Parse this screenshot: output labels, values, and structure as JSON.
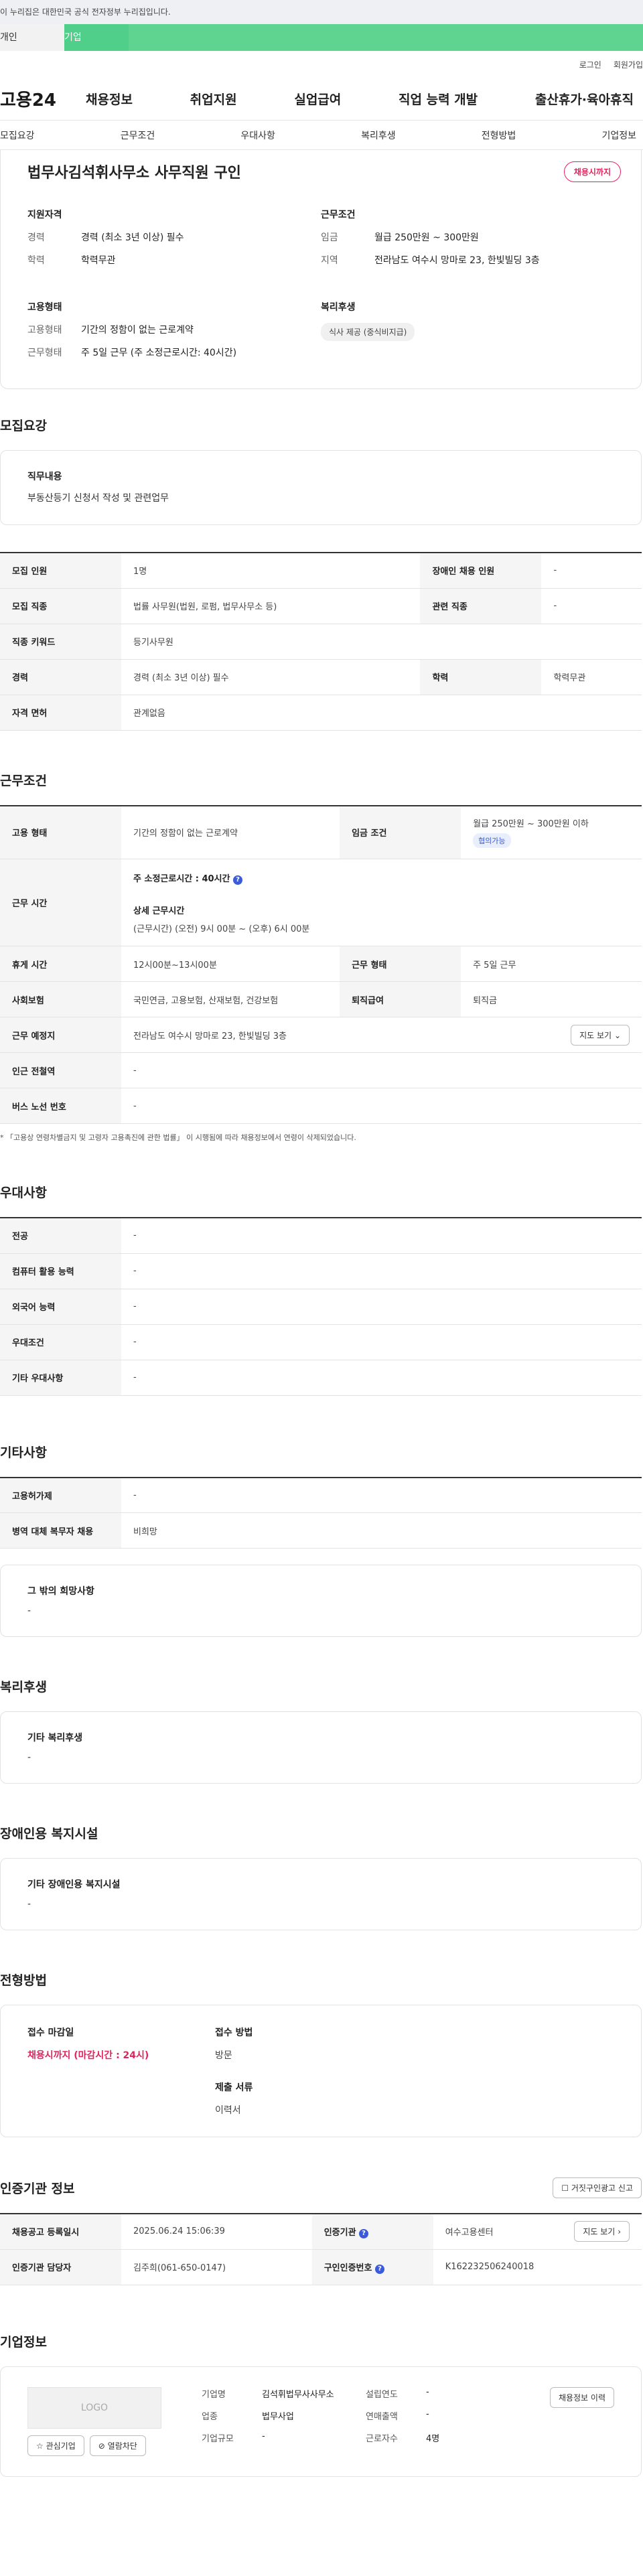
{
  "gov_banner": "이 누리집은 대한민국 공식 전자정부 누리집입니다.",
  "user_tabs": [
    "개인",
    "기업"
  ],
  "util": [
    "로그인",
    "회원가입"
  ],
  "logo": "고용24",
  "gnb": [
    "채용정보",
    "취업지원",
    "실업급여",
    "직업 능력 개발",
    "출산휴가·육아휴직"
  ],
  "subnav": [
    "모집요강",
    "근무조건",
    "우대사항",
    "복리후생",
    "전형방법",
    "기업정보"
  ],
  "summary": {
    "title": "법무사김석휘사무소 사무직원 구인",
    "badge": "채용시까지",
    "qual_label": "지원자격",
    "qual": [
      {
        "k": "경력",
        "v": "경력 (최소 3년 이상) 필수"
      },
      {
        "k": "학력",
        "v": "학력무관"
      }
    ],
    "work_label": "근무조건",
    "work": [
      {
        "k": "임금",
        "v": "월급 250만원 ~ 300만원"
      },
      {
        "k": "지역",
        "v": "전라남도 여수시 망마로 23, 한빛빌딩 3층"
      }
    ],
    "type_label": "고용형태",
    "type": [
      {
        "k": "고용형태",
        "v": "기간의 정함이 없는 근로계약"
      },
      {
        "k": "근무형태",
        "v": "주 5일 근무 (주 소정근로시간: 40시간)"
      }
    ],
    "welfare_label": "복리후생",
    "welfare_chip": "식사 제공 (중식비지급)"
  },
  "recruit": {
    "heading": "모집요강",
    "duty_label": "직무내용",
    "duty": "부동산등기 신청서 작성 및 관련업무",
    "rows": [
      {
        "k1": "모집 인원",
        "v1": "1명",
        "k2": "장애인 채용 인원",
        "v2": "-"
      },
      {
        "k1": "모집 직종",
        "v1": "법률 사무원(법원, 로펌, 법무사무소 등)",
        "k2": "관련 직종",
        "v2": "-"
      },
      {
        "k1": "직종 키워드",
        "v1": "등기사무원"
      },
      {
        "k1": "경력",
        "v1": "경력 (최소 3년 이상) 필수",
        "k2": "학력",
        "v2": "학력무관"
      },
      {
        "k1": "자격 면허",
        "v1": "관계없음"
      }
    ]
  },
  "work": {
    "heading": "근무조건",
    "type_k": "고용 형태",
    "type_v": "기간의 정함이 없는 근로계약",
    "wage_k": "임금 조건",
    "wage_v": "월급 250만원 ~ 300만원 이하",
    "wage_pill": "협의가능",
    "hours_k": "근무 시간",
    "hours_main": "주 소정근로시간 : 40시간",
    "hours_detail_label": "상세 근무시간",
    "hours_detail": "(근무시간) (오전) 9시 00분 ~ (오후) 6시 00분",
    "rest_k": "휴게 시간",
    "rest_v": "12시00분~13시00분",
    "form_k": "근무 형태",
    "form_v": "주 5일 근무",
    "ins_k": "사회보험",
    "ins_v": "국민연금, 고용보험, 산재보험, 건강보험",
    "ret_k": "퇴직급여",
    "ret_v": "퇴직금",
    "place_k": "근무 예정지",
    "place_v": "전라남도 여수시 망마로 23, 한빛빌딩 3층",
    "map_btn": "지도 보기",
    "subway_k": "인근 전철역",
    "subway_v": "-",
    "bus_k": "버스 노선 번호",
    "bus_v": "-",
    "note": "* 「고용상 연령차별금지 및 고령자 고용촉진에 관한 법률」 이 시행됨에 따라 채용정보에서 연령이 삭제되었습니다."
  },
  "pref": {
    "heading": "우대사항",
    "rows": [
      {
        "k": "전공",
        "v": "-"
      },
      {
        "k": "컴퓨터 활용 능력",
        "v": "-"
      },
      {
        "k": "외국어 능력",
        "v": "-"
      },
      {
        "k": "우대조건",
        "v": "-"
      },
      {
        "k": "기타 우대사항",
        "v": "-"
      }
    ]
  },
  "etc": {
    "heading": "기타사항",
    "rows": [
      {
        "k": "고용허가제",
        "v": "-"
      },
      {
        "k": "병역 대체 복무자 채용",
        "v": "비희망"
      }
    ],
    "hope_label": "그 밖의 희망사항",
    "hope": "-"
  },
  "welfare": {
    "heading": "복리후생",
    "label": "기타 복리후생",
    "val": "-"
  },
  "disabled": {
    "heading": "장애인용 복지시설",
    "label": "기타 장애인용 복지시설",
    "val": "-"
  },
  "process": {
    "heading": "전형방법",
    "deadline_label": "접수 마감일",
    "deadline": "채용시까지 (마감시간 : 24시)",
    "method_label": "접수 방법",
    "method": "방문",
    "docs_label": "제출 서류",
    "docs": "이력서"
  },
  "agency": {
    "heading": "인증기관 정보",
    "report_btn": "거짓구인광고 신고",
    "reg_k": "채용공고 등록일시",
    "reg_v": "2025.06.24 15:06:39",
    "agency_k": "인증기관",
    "agency_v": "여수고용센터",
    "map_btn": "지도 보기",
    "manager_k": "인증기관 담당자",
    "manager_v": "김주희(061-650-0147)",
    "auth_k": "구인인증번호",
    "auth_v": "K162232506240018"
  },
  "company": {
    "heading": "기업정보",
    "logo": "LOGO",
    "fav_btn": "관심기업",
    "block_btn": "열람차단",
    "name_k": "기업명",
    "name_v": "김석휘법무사사무소",
    "industry_k": "업종",
    "industry_v": "법무사업",
    "size_k": "기업규모",
    "size_v": "-",
    "est_k": "설립연도",
    "est_v": "-",
    "sales_k": "연매출액",
    "sales_v": "-",
    "emp_k": "근로자수",
    "emp_v": "4명",
    "history_btn": "채용정보 이력"
  }
}
